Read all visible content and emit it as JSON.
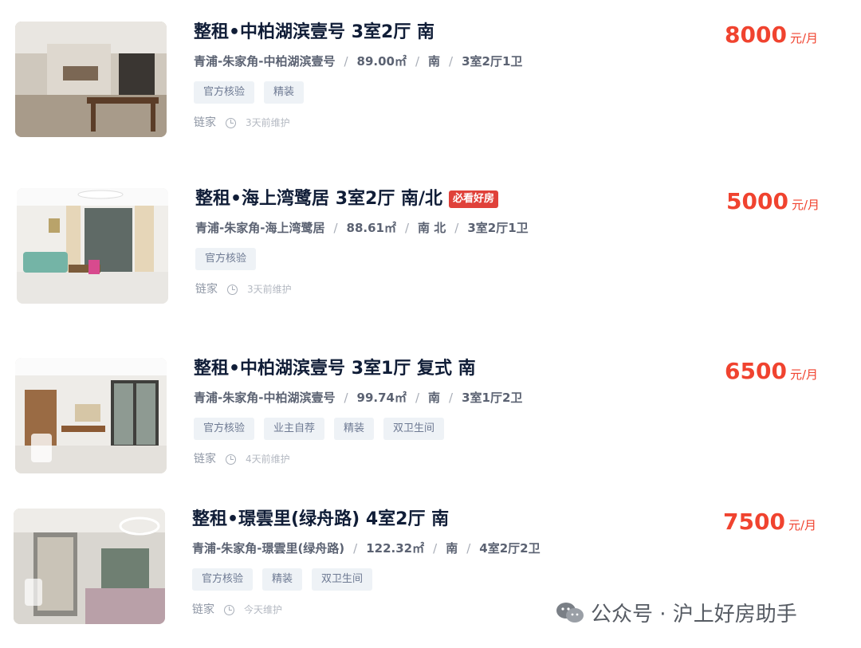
{
  "listings": [
    {
      "title": "整租•中柏湖滨壹号 3室2厅 南",
      "badge": "",
      "location": "青浦-朱家角-中柏湖滨壹号",
      "area": "89.00㎡",
      "orientation": "南",
      "layout": "3室2厅1卫",
      "tags": [
        "官方核验",
        "精装"
      ],
      "source": "链家",
      "updated": "3天前维护",
      "price": "8000",
      "price_unit": "元/月"
    },
    {
      "title": "整租•海上湾鹭居 3室2厅 南/北",
      "badge": "必看好房",
      "location": "青浦-朱家角-海上湾鹭居",
      "area": "88.61㎡",
      "orientation": "南 北",
      "layout": "3室2厅1卫",
      "tags": [
        "官方核验"
      ],
      "source": "链家",
      "updated": "3天前维护",
      "price": "5000",
      "price_unit": "元/月"
    },
    {
      "title": "整租•中柏湖滨壹号 3室1厅 复式 南",
      "badge": "",
      "location": "青浦-朱家角-中柏湖滨壹号",
      "area": "99.74㎡",
      "orientation": "南",
      "layout": "3室1厅2卫",
      "tags": [
        "官方核验",
        "业主自荐",
        "精装",
        "双卫生间"
      ],
      "source": "链家",
      "updated": "4天前维护",
      "price": "6500",
      "price_unit": "元/月"
    },
    {
      "title": "整租•璟雲里(绿舟路) 4室2厅 南",
      "badge": "",
      "location": "青浦-朱家角-璟雲里(绿舟路)",
      "area": "122.32㎡",
      "orientation": "南",
      "layout": "4室2厅2卫",
      "tags": [
        "官方核验",
        "精装",
        "双卫生间"
      ],
      "source": "链家",
      "updated": "今天维护",
      "price": "7500",
      "price_unit": "元/月"
    }
  ],
  "icons": {
    "clock": "clock-icon",
    "wechat": "wechat-icon"
  },
  "colors": {
    "price": "#f0432f",
    "badge": "#e0413a",
    "tag_bg": "#eef2f6"
  },
  "watermark": {
    "text": "公众号 · 沪上好房助手"
  }
}
